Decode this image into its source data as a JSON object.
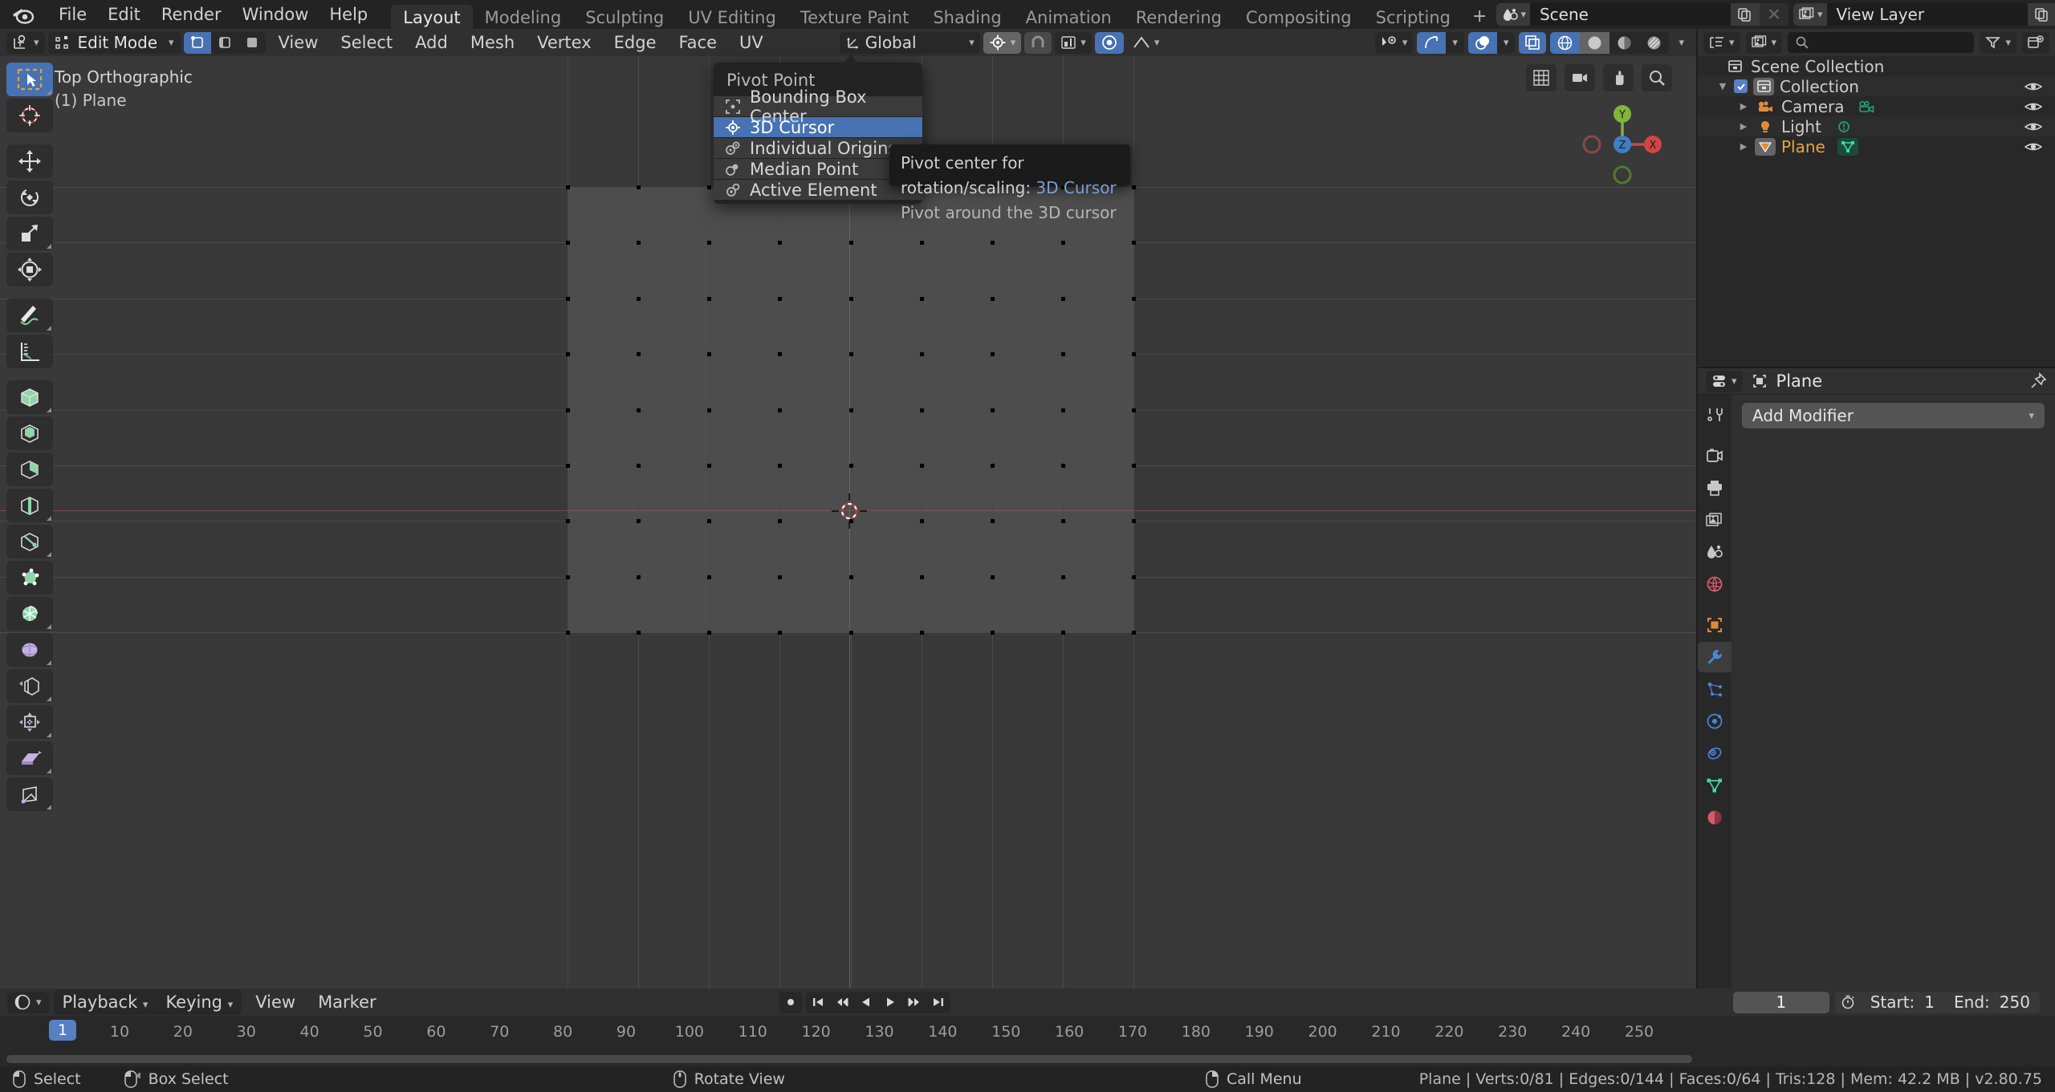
{
  "topbar": {
    "logo_icon": "blender-logo-icon",
    "menus": [
      "File",
      "Edit",
      "Render",
      "Window",
      "Help"
    ],
    "workspaces": [
      {
        "label": "Layout",
        "active": true
      },
      {
        "label": "Modeling",
        "active": false
      },
      {
        "label": "Sculpting",
        "active": false
      },
      {
        "label": "UV Editing",
        "active": false
      },
      {
        "label": "Texture Paint",
        "active": false
      },
      {
        "label": "Shading",
        "active": false
      },
      {
        "label": "Animation",
        "active": false
      },
      {
        "label": "Rendering",
        "active": false
      },
      {
        "label": "Compositing",
        "active": false
      },
      {
        "label": "Scripting",
        "active": false
      }
    ],
    "add_workspace_label": "+",
    "scene": {
      "icon": "scene-icon",
      "name": "Scene",
      "new_icon": "duplicate-icon",
      "unlink_icon": "x-icon"
    },
    "view_layer": {
      "icon": "view-layer-icon",
      "name": "View Layer",
      "new_icon": "duplicate-icon",
      "unlink_icon": "x-icon"
    }
  },
  "viewport_header": {
    "editor_type_icon": "editor-type-3dview-icon",
    "mode": "Edit Mode",
    "select_modes": [
      {
        "name": "vertex-select-mode",
        "active": true
      },
      {
        "name": "edge-select-mode",
        "active": false
      },
      {
        "name": "face-select-mode",
        "active": false
      }
    ],
    "menus": [
      "View",
      "Select",
      "Add",
      "Mesh",
      "Vertex",
      "Edge",
      "Face",
      "UV"
    ],
    "transform_orientation": "Global",
    "pivot_icon": "pivot-3d-cursor-icon",
    "snap_icon": "magnet-icon",
    "snap_target_icon": "snap-increment-icon",
    "proportional_edit_icon": "proportional-editing-icon",
    "proportional_falloff_icon": "smooth-falloff-icon",
    "right_controls": [
      {
        "name": "visibility-icon",
        "active": false
      },
      {
        "name": "gizmo-icon",
        "active": true
      },
      {
        "name": "overlays-icon",
        "active": true
      },
      {
        "name": "xray-toggle-icon",
        "active": true
      },
      {
        "name": "shading-wireframe-icon",
        "active": true
      },
      {
        "name": "shading-solid-icon",
        "active": false
      },
      {
        "name": "shading-material-icon",
        "active": false
      },
      {
        "name": "shading-rendered-icon",
        "active": false
      }
    ]
  },
  "viewport": {
    "view_name": "Top Orthographic",
    "object_name": "(1) Plane",
    "grid_color": "#4a4a4a",
    "x_axis_color": "#7a4652",
    "y_axis_color": "#5b6b42",
    "nav_axes": {
      "x": "X",
      "y": "Y",
      "z": "Z"
    }
  },
  "pivot_menu": {
    "title": "Pivot Point",
    "items": [
      {
        "label": "Bounding Box Center",
        "icon": "pivot-boundbox-icon",
        "highlighted": false
      },
      {
        "label": "3D Cursor",
        "icon": "pivot-cursor-icon",
        "highlighted": true
      },
      {
        "label": "Individual Origins",
        "icon": "pivot-individual-icon",
        "highlighted": false
      },
      {
        "label": "Median Point",
        "icon": "pivot-median-icon",
        "highlighted": false
      },
      {
        "label": "Active Element",
        "icon": "pivot-active-icon",
        "highlighted": false
      }
    ]
  },
  "tooltip": {
    "line1_label": "Pivot center for rotation/scaling:",
    "line1_value": "3D Cursor",
    "line2": "Pivot around the 3D cursor"
  },
  "outliner": {
    "display_mode_icon": "outliner-display-icon",
    "filter_id_icon": "view-layer-icon",
    "search_placeholder": "",
    "search_icon": "search-icon",
    "filter_icon": "funnel-icon",
    "new_collection_icon": "new-collection-icon",
    "rows": [
      {
        "label": "Scene Collection",
        "icon": "collection-icon",
        "indent": 0,
        "expand": "",
        "checkbox": false,
        "eye": false,
        "selected": false,
        "data_icon": ""
      },
      {
        "label": "Collection",
        "icon": "collection-icon",
        "indent": 1,
        "expand": "down",
        "checkbox": true,
        "eye": true,
        "selected": true,
        "data_icon": ""
      },
      {
        "label": "Camera",
        "icon": "camera-object-icon",
        "indent": 2,
        "expand": "right",
        "checkbox": false,
        "eye": true,
        "selected": false,
        "data_icon": "camera-data-icon"
      },
      {
        "label": "Light",
        "icon": "light-object-icon",
        "indent": 2,
        "expand": "right",
        "checkbox": false,
        "eye": true,
        "selected": false,
        "data_icon": "light-data-icon"
      },
      {
        "label": "Plane",
        "icon": "mesh-object-icon",
        "indent": 2,
        "expand": "right",
        "checkbox": false,
        "eye": true,
        "selected": true,
        "data_icon": "mesh-data-icon"
      }
    ],
    "active_object_color": "#e8a33d"
  },
  "properties": {
    "editor_icon": "properties-editor-icon",
    "breadcrumb_icon": "object-icon",
    "breadcrumb": "Plane",
    "pin_icon": "pin-icon",
    "tabs": [
      {
        "name": "tool-tab",
        "icon": "tool-icon",
        "active": false
      },
      {
        "name": "render-tab",
        "icon": "render-icon",
        "active": false
      },
      {
        "name": "output-tab",
        "icon": "printer-icon",
        "active": false
      },
      {
        "name": "view-layer-tab",
        "icon": "images-icon",
        "active": false
      },
      {
        "name": "scene-tab",
        "icon": "scene-icon",
        "active": false
      },
      {
        "name": "world-tab",
        "icon": "world-icon",
        "active": false
      },
      {
        "name": "object-tab",
        "icon": "object-square-icon",
        "active": false
      },
      {
        "name": "modifier-tab",
        "icon": "wrench-icon",
        "active": true
      },
      {
        "name": "particles-tab",
        "icon": "particles-icon",
        "active": false
      },
      {
        "name": "physics-tab",
        "icon": "physics-icon",
        "active": false
      },
      {
        "name": "constraints-tab",
        "icon": "constraints-icon",
        "active": false
      },
      {
        "name": "data-tab",
        "icon": "mesh-data-icon",
        "active": false
      },
      {
        "name": "material-tab",
        "icon": "material-icon",
        "active": false
      }
    ],
    "add_modifier_label": "Add Modifier",
    "add_modifier_caret": "chevron-down-icon"
  },
  "timeline": {
    "editor_icon": "timeline-editor-icon",
    "menus": [
      "Playback",
      "Keying",
      "View",
      "Marker"
    ],
    "transport": [
      "record-icon",
      "jump-start-icon",
      "prev-keyframe-icon",
      "play-reverse-icon",
      "play-icon",
      "next-keyframe-icon",
      "jump-end-icon"
    ],
    "current_frame": "1",
    "timer_icon": "stopwatch-icon",
    "start_label": "Start:",
    "start_value": "1",
    "end_label": "End:",
    "end_value": "250",
    "ruler_ticks": [
      10,
      20,
      30,
      40,
      50,
      60,
      70,
      80,
      90,
      100,
      110,
      120,
      130,
      140,
      150,
      160,
      170,
      180,
      190,
      200,
      210,
      220,
      230,
      240,
      250
    ],
    "playhead_frame": "1"
  },
  "statusbar": {
    "shortcuts": [
      {
        "icon": "mouse-left-icon",
        "label": "Select"
      },
      {
        "icon": "mouse-drag-icon",
        "label": "Box Select"
      },
      {
        "icon": "mouse-middle-icon",
        "label": "Rotate View"
      },
      {
        "icon": "mouse-right-icon",
        "label": "Call Menu"
      }
    ],
    "stats": "Plane | Verts:0/81 | Edges:0/144 | Faces:0/64 | Tris:128 | Mem: 42.2 MB | v2.80.75"
  }
}
